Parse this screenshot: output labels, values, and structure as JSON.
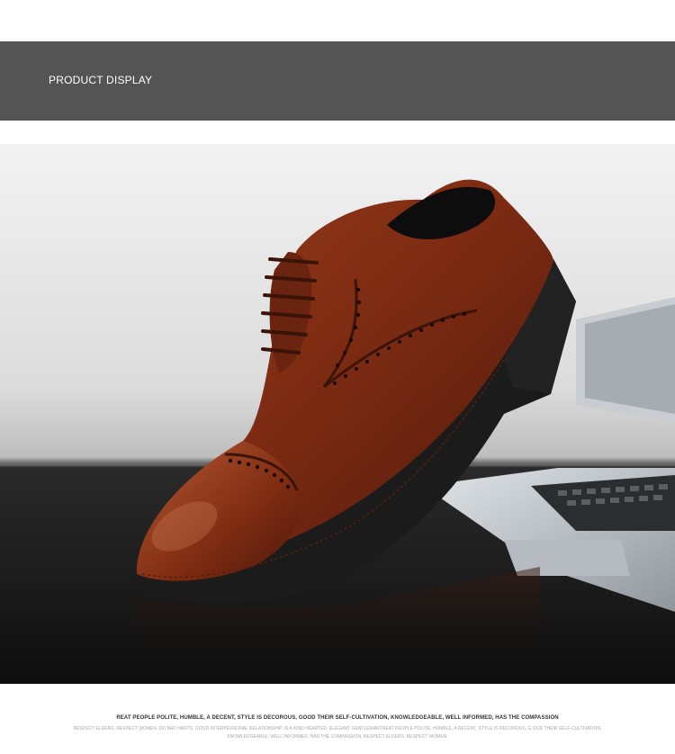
{
  "header": {
    "title": "PRODUCT DISPLAY",
    "background_color": "#545454"
  },
  "product_photo": {
    "subject": "brown-leather-cap-toe-brogue-oxford-shoe",
    "shoe_color": "#7a2a12",
    "sole_color": "#1b1b1b"
  },
  "caption": {
    "main": "REAT PEOPLE POLITE, HUMBLE, A DECENT, STYLE IS DECOROUS, GOOD THEIR SELF-CULTIVATION, KNOWLEDGEABLE, WELL INFORMED, HAS THE COMPASSION",
    "sub": "RESPECT ELDERS, RESPECT WOMEN, DO BAD HARTS. GOOD INTERPERSONAL RELATIONSHIP, IS A KIND-HEARTED, ELEGANT GENTLEMANTREAT PEOPLE POLITE, HUMBLE, A DECENT, STYLE IS DECOROUS, G OOD THEIR SELF-CULTIVATION, KNOWLEDGEABLE, WELL INFORMED, HAS THE COMPASSION, RESPECT ELDERS, RESPECT WOMEN."
  }
}
